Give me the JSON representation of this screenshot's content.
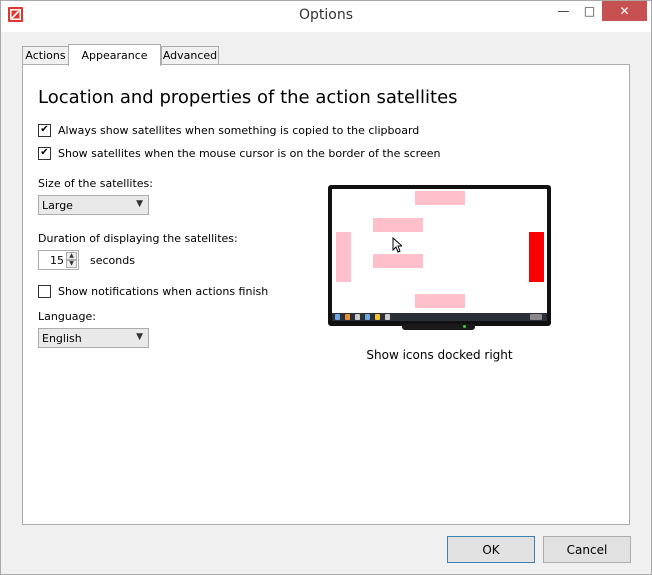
{
  "window": {
    "title": "Options"
  },
  "titlebar": {
    "minimize": "—",
    "maximize": "□",
    "close": "✕"
  },
  "tabs": [
    {
      "label": "Actions"
    },
    {
      "label": "Appearance",
      "selected": true
    },
    {
      "label": "Advanced"
    }
  ],
  "appearance": {
    "heading": "Location and properties of the action satellites",
    "checkboxes": [
      {
        "label": "Always show satellites when something is copied to the clipboard",
        "checked": true
      },
      {
        "label": "Show satellites when the mouse cursor is on the border of the screen",
        "checked": true
      },
      {
        "label": "Show notifications when actions finish",
        "checked": false
      }
    ],
    "size_label": "Size of the satellites:",
    "size_value": "Large",
    "duration_label": "Duration of displaying the satellites:",
    "duration_value": "15",
    "duration_unit": "seconds",
    "language_label": "Language:",
    "language_value": "English",
    "preview_caption": "Show icons docked right"
  },
  "colors": {
    "satellite": "#ffc0cb",
    "satellite_active": "#ff0000",
    "close_button": "#c75050"
  },
  "buttons": {
    "ok": "OK",
    "cancel": "Cancel"
  }
}
